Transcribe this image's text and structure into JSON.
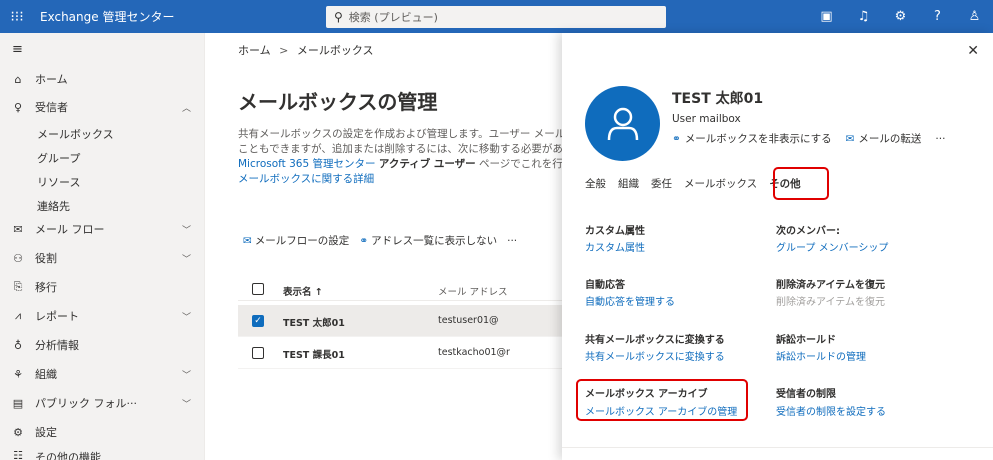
{
  "topbar": {
    "app_name": "Exchange 管理センター",
    "search_placeholder": "検索 (プレビュー)"
  },
  "nav": {
    "items": [
      {
        "label": "ホーム"
      },
      {
        "label": "受信者"
      },
      {
        "label": "メール フロー"
      },
      {
        "label": "役割"
      },
      {
        "label": "移行"
      },
      {
        "label": "レポート"
      },
      {
        "label": "分析情報"
      },
      {
        "label": "組織"
      },
      {
        "label": "パブリック フォル···"
      },
      {
        "label": "設定"
      },
      {
        "label": "その他の機能"
      }
    ],
    "sub_items": [
      "メールボックス",
      "グループ",
      "リソース",
      "連絡先"
    ]
  },
  "main": {
    "breadcrumb_home": "ホーム",
    "breadcrumb_sep": ">",
    "breadcrumb_current": "メールボックス",
    "title": "メールボックスの管理",
    "desc_line1": "共有メールボックスの設定を作成および管理します。ユーザー メールボ",
    "desc_line2": "こともできますが、追加または削除するには、次に移動する必要があり",
    "desc_link1": "Microsoft 365 管理センター",
    "desc_bold": "アクティブ ユーザー",
    "desc_line3_tail": "ページでこれを行う",
    "desc_link2": "メールボックスに関する詳細",
    "toolbar_mailflow": "メールフローの設定",
    "toolbar_addrlist": "アドレス一覧に表示しない",
    "toolbar_more": "···",
    "col_name": "表示名 ↑",
    "col_mail": "メール アドレス",
    "rows": [
      {
        "name": "TEST 太郎01",
        "mail": "testuser01@"
      },
      {
        "name": "TEST 課長01",
        "mail": "testkacho01@r"
      }
    ]
  },
  "panel": {
    "name": "TEST 太郎01",
    "type": "User mailbox",
    "action_hide": "メールボックスを非表示にする",
    "action_forward": "メールの転送",
    "action_more": "···",
    "tabs": [
      "全般",
      "組織",
      "委任",
      "メールボックス",
      "その他"
    ],
    "sections": [
      {
        "title": "カスタム属性",
        "link": "カスタム属性"
      },
      {
        "title": "次のメンバー:",
        "link": "グループ メンバーシップ"
      },
      {
        "title": "自動応答",
        "link": "自動応答を管理する"
      },
      {
        "title": "削除済みアイテムを復元",
        "link": "削除済みアイテムを復元"
      },
      {
        "title": "共有メールボックスに変換する",
        "link": "共有メールボックスに変換する"
      },
      {
        "title": "訴訟ホールド",
        "link": "訴訟ホールドの管理"
      },
      {
        "title": "メールボックス アーカイブ",
        "link": "メールボックス アーカイブの管理"
      },
      {
        "title": "受信者の制限",
        "link": "受信者の制限を設定する"
      }
    ]
  },
  "colors": {
    "topbar": "#2467b8",
    "accent": "#0f6cbd",
    "highlight": "#e00000"
  }
}
